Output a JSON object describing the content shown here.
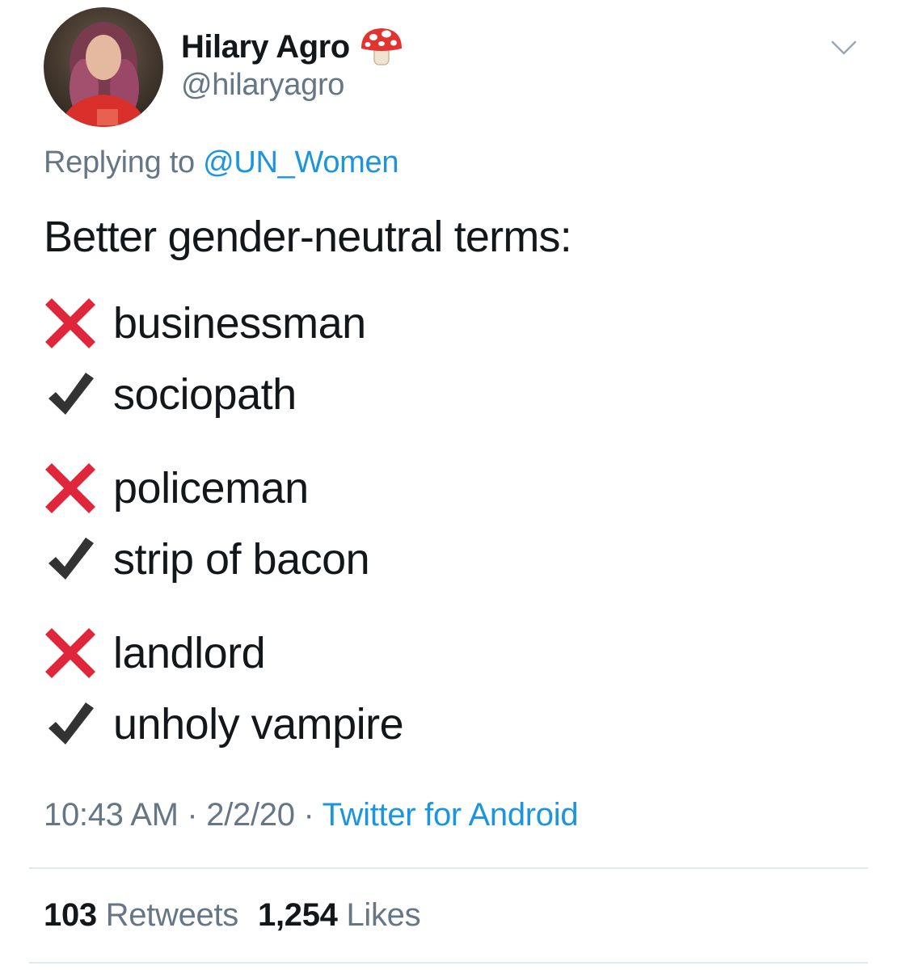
{
  "author": {
    "display_name": "Hilary Agro",
    "handle": "@hilaryagro",
    "name_emoji": "mushroom-icon"
  },
  "reply": {
    "prefix": "Replying to ",
    "mention": "@UN_Women"
  },
  "tweet": {
    "intro": "Better gender-neutral terms:",
    "pairs": [
      {
        "wrong": "businessman",
        "right": "sociopath"
      },
      {
        "wrong": "policeman",
        "right": "strip of bacon"
      },
      {
        "wrong": "landlord",
        "right": "unholy vampire"
      }
    ]
  },
  "meta": {
    "time": "10:43 AM",
    "separator": " · ",
    "date": "2/2/20",
    "source": "Twitter for Android"
  },
  "stats": {
    "retweets_count": "103",
    "retweets_label": "Retweets",
    "likes_count": "1,254",
    "likes_label": "Likes"
  },
  "icons": {
    "wrong_mark": "cross-mark-icon",
    "right_mark": "check-mark-icon",
    "more": "chevron-down-icon"
  },
  "colors": {
    "link": "#1b95e0",
    "secondary_text": "#657786",
    "primary_text": "#14171a",
    "cross_red": "#e0263a",
    "check_dark": "#333333",
    "divider": "#e1e8ed"
  }
}
